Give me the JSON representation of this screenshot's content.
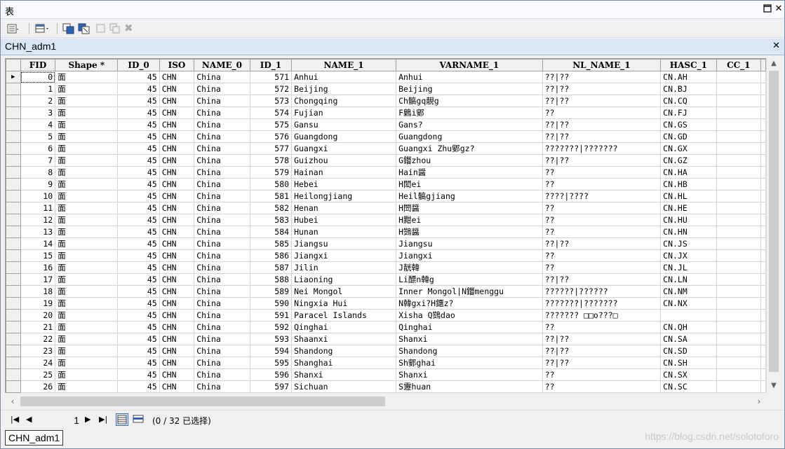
{
  "window": {
    "title": "表"
  },
  "tab": {
    "title": "CHN_adm1"
  },
  "columns": [
    "FID",
    "Shape *",
    "ID_0",
    "ISO",
    "NAME_0",
    "ID_1",
    "NAME_1",
    "VARNAME_1",
    "NL_NAME_1",
    "HASC_1",
    "CC_1"
  ],
  "rows": [
    [
      "0",
      "面",
      "45",
      "CHN",
      "China",
      "571",
      "Anhui",
      "Anhui",
      "??|??",
      "CN.AH",
      ""
    ],
    [
      "1",
      "面",
      "45",
      "CHN",
      "China",
      "572",
      "Beijing",
      "Beijing",
      "??|??",
      "CN.BJ",
      ""
    ],
    [
      "2",
      "面",
      "45",
      "CHN",
      "China",
      "573",
      "Chongqing",
      "Ch髇gq靚g",
      "??|??",
      "CN.CQ",
      ""
    ],
    [
      "3",
      "面",
      "45",
      "CHN",
      "China",
      "574",
      "Fujian",
      "F鷍i鄋",
      "??",
      "CN.FJ",
      ""
    ],
    [
      "4",
      "面",
      "45",
      "CHN",
      "China",
      "575",
      "Gansu",
      "Gans?",
      "??|??",
      "CN.GS",
      ""
    ],
    [
      "5",
      "面",
      "45",
      "CHN",
      "China",
      "576",
      "Guangdong",
      "Guangdong",
      "??|??",
      "CN.GD",
      ""
    ],
    [
      "6",
      "面",
      "45",
      "CHN",
      "China",
      "577",
      "Guangxi",
      "Guangxi Zhu鄋gz?",
      "???????|???????",
      "CN.GX",
      ""
    ],
    [
      "7",
      "面",
      "45",
      "CHN",
      "China",
      "578",
      "Guizhou",
      "G鑙zhou",
      "??|??",
      "CN.GZ",
      ""
    ],
    [
      "8",
      "面",
      "45",
      "CHN",
      "China",
      "579",
      "Hainan",
      "Hain醤",
      "??",
      "CN.HA",
      ""
    ],
    [
      "9",
      "面",
      "45",
      "CHN",
      "China",
      "580",
      "Hebei",
      "H閎ei",
      "??",
      "CN.HB",
      ""
    ],
    [
      "10",
      "面",
      "45",
      "CHN",
      "China",
      "581",
      "Heilongjiang",
      "Heil髇gjiang",
      "????|????",
      "CN.HL",
      ""
    ],
    [
      "11",
      "面",
      "45",
      "CHN",
      "China",
      "582",
      "Henan",
      "H閚醤",
      "??",
      "CN.HE",
      ""
    ],
    [
      "12",
      "面",
      "45",
      "CHN",
      "China",
      "583",
      "Hubei",
      "H黚ei",
      "??",
      "CN.HU",
      ""
    ],
    [
      "13",
      "面",
      "45",
      "CHN",
      "China",
      "584",
      "Hunan",
      "H鷑醤",
      "??",
      "CN.HN",
      ""
    ],
    [
      "14",
      "面",
      "45",
      "CHN",
      "China",
      "585",
      "Jiangsu",
      "Jiangsu",
      "??|??",
      "CN.JS",
      ""
    ],
    [
      "15",
      "面",
      "45",
      "CHN",
      "China",
      "586",
      "Jiangxi",
      "Jiangxi",
      "??",
      "CN.JX",
      ""
    ],
    [
      "16",
      "面",
      "45",
      "CHN",
      "China",
      "587",
      "Jilin",
      "J靗韓",
      "??",
      "CN.JL",
      ""
    ],
    [
      "17",
      "面",
      "45",
      "CHN",
      "China",
      "588",
      "Liaoning",
      "Li醥n韓g",
      "??|??",
      "CN.LN",
      ""
    ],
    [
      "18",
      "面",
      "45",
      "CHN",
      "China",
      "589",
      "Nei Mongol",
      "Inner Mongol|N鑙menggu",
      "??????|??????",
      "CN.NM",
      ""
    ],
    [
      "19",
      "面",
      "45",
      "CHN",
      "China",
      "590",
      "Ningxia Hui",
      "N韓gxi?H鏸z?",
      "???????|???????",
      "CN.NX",
      ""
    ],
    [
      "20",
      "面",
      "45",
      "CHN",
      "China",
      "591",
      "Paracel Islands",
      "Xisha Q鷑dao",
      "???????  □□o???□",
      "",
      ""
    ],
    [
      "21",
      "面",
      "45",
      "CHN",
      "China",
      "592",
      "Qinghai",
      "Qinghai",
      "??",
      "CN.QH",
      ""
    ],
    [
      "22",
      "面",
      "45",
      "CHN",
      "China",
      "593",
      "Shaanxi",
      "Shanxi",
      "??|??",
      "CN.SA",
      ""
    ],
    [
      "23",
      "面",
      "45",
      "CHN",
      "China",
      "594",
      "Shandong",
      "Shandong",
      "??|??",
      "CN.SD",
      ""
    ],
    [
      "24",
      "面",
      "45",
      "CHN",
      "China",
      "595",
      "Shanghai",
      "Sh鄋ghai",
      "??|??",
      "CN.SH",
      ""
    ],
    [
      "25",
      "面",
      "45",
      "CHN",
      "China",
      "596",
      "Shanxi",
      "Shanxi",
      "??",
      "CN.SX",
      ""
    ],
    [
      "26",
      "面",
      "45",
      "CHN",
      "China",
      "597",
      "Sichuan",
      "S靋huan",
      "??",
      "CN.SC",
      ""
    ]
  ],
  "nav": {
    "page": "1",
    "status": "(0 / 32 已选择)"
  },
  "bottom_tab": "CHN_adm1",
  "watermark": "https://blog.csdn.net/solotoforo"
}
